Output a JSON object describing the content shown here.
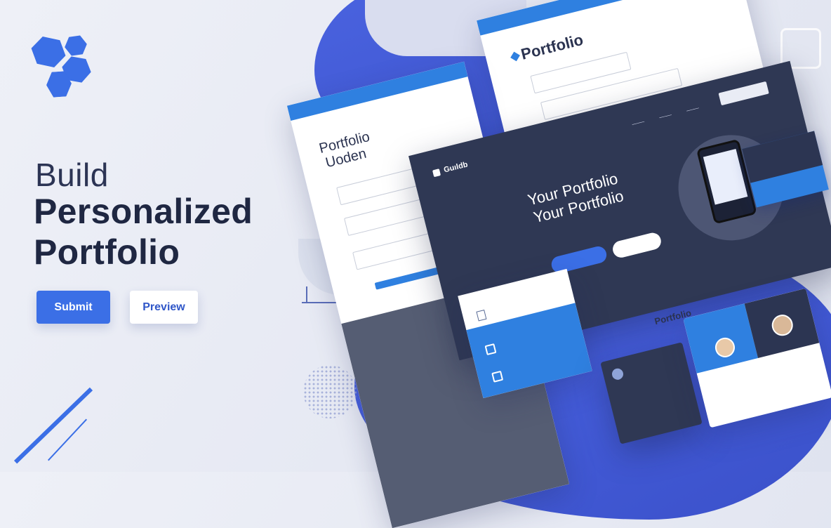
{
  "hero": {
    "line1": "Build",
    "line2": "Personalized",
    "line3": "Portfolio",
    "submit_label": "Submit",
    "preview_label": "Preview"
  },
  "form_card_top": {
    "title": "Portfolio"
  },
  "form_card_left": {
    "title_line1": "Portfolio",
    "title_line2": "Uoden"
  },
  "dark_screen": {
    "brand": "Guıldb",
    "headline_line1": "Your Portfolio",
    "headline_line2": "Your Portfolio"
  },
  "portfolio_section": {
    "title": "Portfolio"
  },
  "colors": {
    "accent": "#3b6fe6",
    "dark": "#2f3854",
    "headline": "#1f2742"
  },
  "icons": [
    "hexagon-logo-icon",
    "lock-icon",
    "document-icon",
    "window-icon"
  ]
}
